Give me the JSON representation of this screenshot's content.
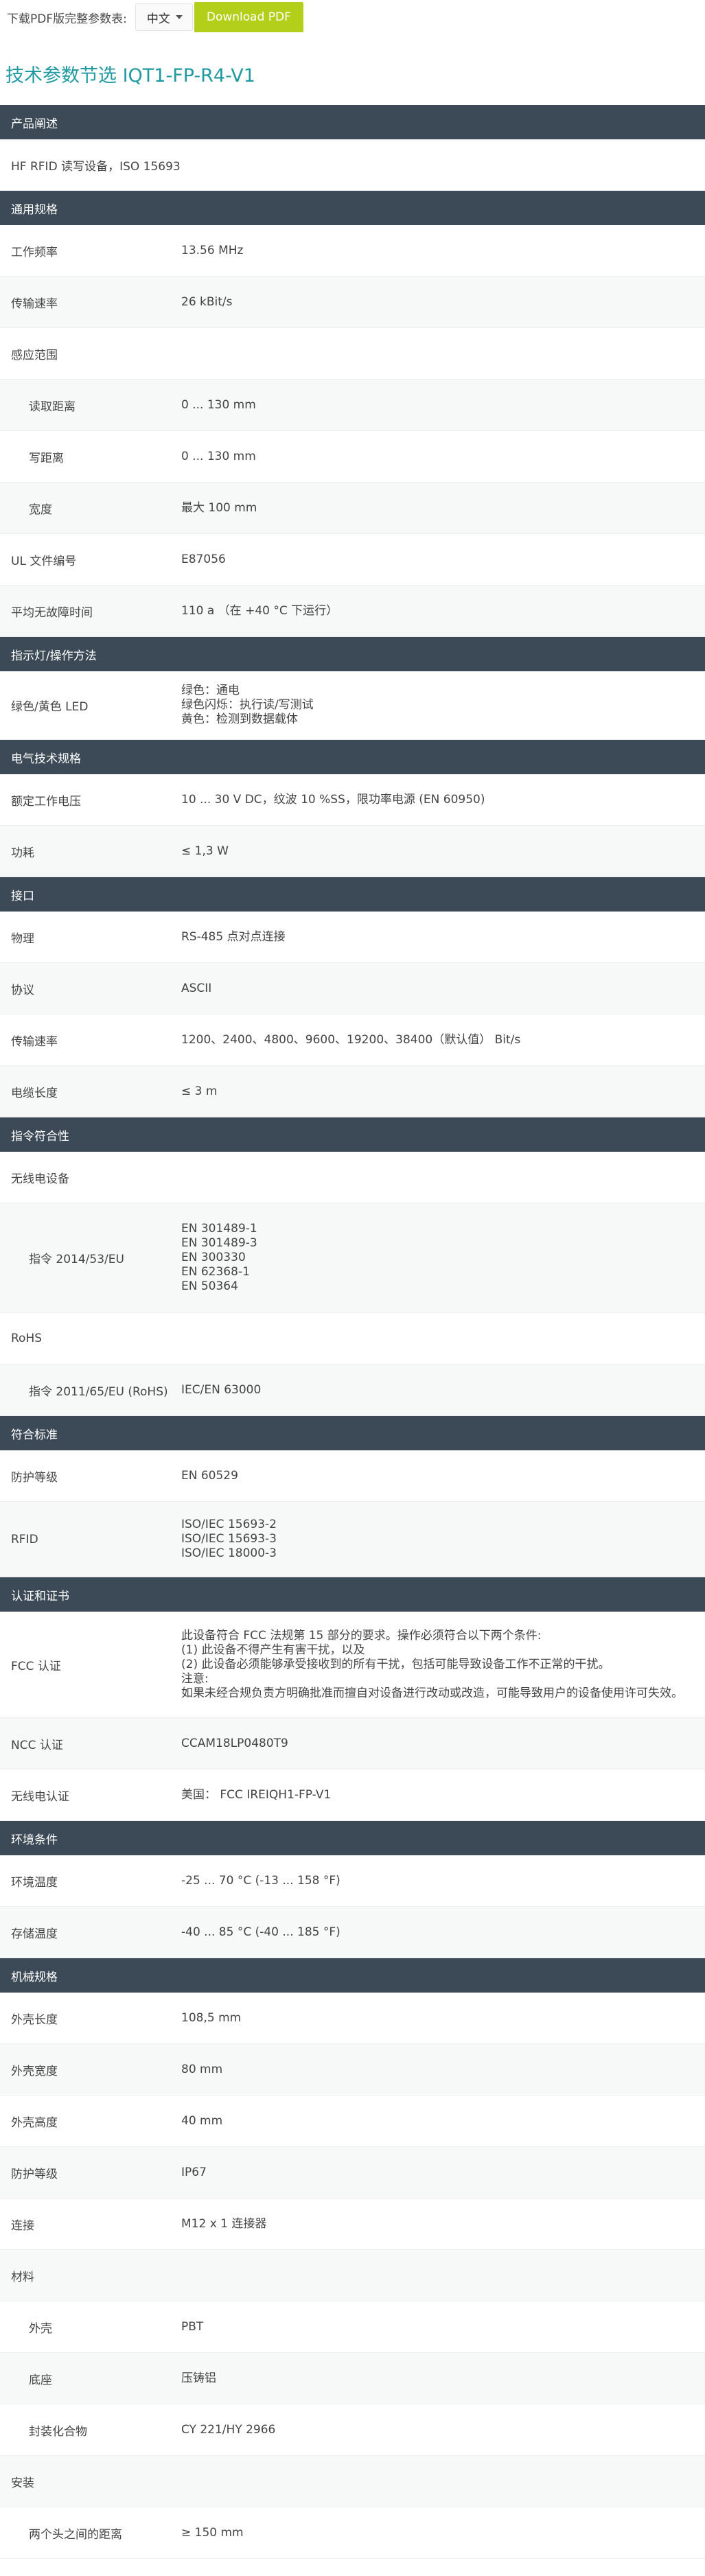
{
  "topbar": {
    "download_prompt": "下载PDF版完整参数表:",
    "language": "中文",
    "download_button": "Download PDF"
  },
  "page_title": "技术参数节选  IQT1-FP-R4-V1",
  "sections": [
    {
      "title": "产品阐述",
      "rows": [
        {
          "label": "HF RFID 读写设备，ISO 15693",
          "full": true
        }
      ]
    },
    {
      "title": "通用规格",
      "rows": [
        {
          "label": "工作频率",
          "values": [
            "13.56 MHz"
          ]
        },
        {
          "label": "传输速率",
          "values": [
            "26 kBit/s"
          ]
        },
        {
          "label": "感应范围",
          "values": []
        },
        {
          "label": "读取距离",
          "sub": true,
          "values": [
            "0 ... 130 mm"
          ]
        },
        {
          "label": "写距离",
          "sub": true,
          "values": [
            "0 ... 130 mm"
          ]
        },
        {
          "label": "宽度",
          "sub": true,
          "values": [
            "最大 100 mm"
          ]
        },
        {
          "label": "UL 文件编号",
          "values": [
            "E87056"
          ]
        },
        {
          "label": "平均无故障时间",
          "values": [
            "110 a （在 +40 °C 下运行）"
          ]
        }
      ]
    },
    {
      "title": "指示灯/操作方法",
      "rows": [
        {
          "label": "绿色/黄色 LED",
          "values": [
            "绿色：通电",
            "绿色闪烁：执行读/写测试",
            "黄色：检测到数据载体"
          ],
          "height": 100
        }
      ]
    },
    {
      "title": "电气技术规格",
      "rows": [
        {
          "label": "额定工作电压",
          "values": [
            "10 ... 30 V DC，纹波 10 %SS，限功率电源 (EN 60950)"
          ]
        },
        {
          "label": "功耗",
          "values": [
            "≤ 1,3 W"
          ]
        }
      ]
    },
    {
      "title": "接口",
      "rows": [
        {
          "label": "物理",
          "values": [
            "RS-485 点对点连接"
          ]
        },
        {
          "label": "协议",
          "values": [
            "ASCII"
          ]
        },
        {
          "label": "传输速率",
          "values": [
            "1200、2400、4800、9600、19200、38400（默认值） Bit/s"
          ]
        },
        {
          "label": "电缆长度",
          "values": [
            "≤ 3 m"
          ]
        }
      ]
    },
    {
      "title": "指令符合性",
      "rows": [
        {
          "label": "无线电设备",
          "values": []
        },
        {
          "label": "指令 2014/53/EU",
          "sub": true,
          "values": [
            "EN 301489-1",
            "EN 301489-3",
            "EN 300330",
            "EN 62368-1",
            "EN 50364"
          ],
          "height": 160
        },
        {
          "label": "RoHS",
          "values": []
        },
        {
          "label": "指令 2011/65/EU (RoHS)",
          "sub": true,
          "values": [
            "IEC/EN 63000"
          ]
        }
      ]
    },
    {
      "title": "符合标准",
      "rows": [
        {
          "label": "防护等级",
          "values": [
            "EN 60529"
          ]
        },
        {
          "label": "RFID",
          "values": [
            "ISO/IEC 15693-2",
            "ISO/IEC 15693-3",
            "ISO/IEC 18000-3"
          ],
          "height": 110
        }
      ]
    },
    {
      "title": "认证和证书",
      "rows": [
        {
          "label": "FCC 认证",
          "values": [
            "此设备符合 FCC 法规第 15 部分的要求。操作必须符合以下两个条件:",
            "(1) 此设备不得产生有害干扰，以及",
            "(2) 此设备必须能够承受接收到的所有干扰，包括可能导致设备工作不正常的干扰。",
            "注意:",
            "如果未经合规负责方明确批准而擅自对设备进行改动或改造，可能导致用户的设备使用许可失效。"
          ],
          "height": 155
        },
        {
          "label": "NCC 认证",
          "values": [
            "CCAM18LP0480T9"
          ]
        },
        {
          "label": "无线电认证",
          "values": [
            "美国： FCC IREIQH1-FP-V1"
          ]
        }
      ]
    },
    {
      "title": "环境条件",
      "rows": [
        {
          "label": "环境温度",
          "values": [
            "-25 ... 70 °C (-13 ... 158 °F)"
          ]
        },
        {
          "label": "存储温度",
          "values": [
            "-40 ... 85 °C (-40 ... 185 °F)"
          ]
        }
      ]
    },
    {
      "title": "机械规格",
      "rows": [
        {
          "label": "外壳长度",
          "values": [
            "108,5 mm"
          ]
        },
        {
          "label": "外壳宽度",
          "values": [
            "80 mm"
          ]
        },
        {
          "label": "外壳高度",
          "values": [
            "40 mm"
          ]
        },
        {
          "label": "防护等级",
          "values": [
            "IP67"
          ]
        },
        {
          "label": "连接",
          "values": [
            "M12 x 1 连接器"
          ]
        },
        {
          "label": "材料",
          "values": []
        },
        {
          "label": "外壳",
          "sub": true,
          "values": [
            "PBT"
          ]
        },
        {
          "label": "底座",
          "sub": true,
          "values": [
            "压铸铝"
          ]
        },
        {
          "label": "封装化合物",
          "sub": true,
          "values": [
            "CY 221/HY 2966"
          ]
        },
        {
          "label": "安装",
          "values": []
        },
        {
          "label": "两个头之间的距离",
          "sub": true,
          "values": [
            "≥ 150 mm"
          ]
        }
      ]
    }
  ]
}
